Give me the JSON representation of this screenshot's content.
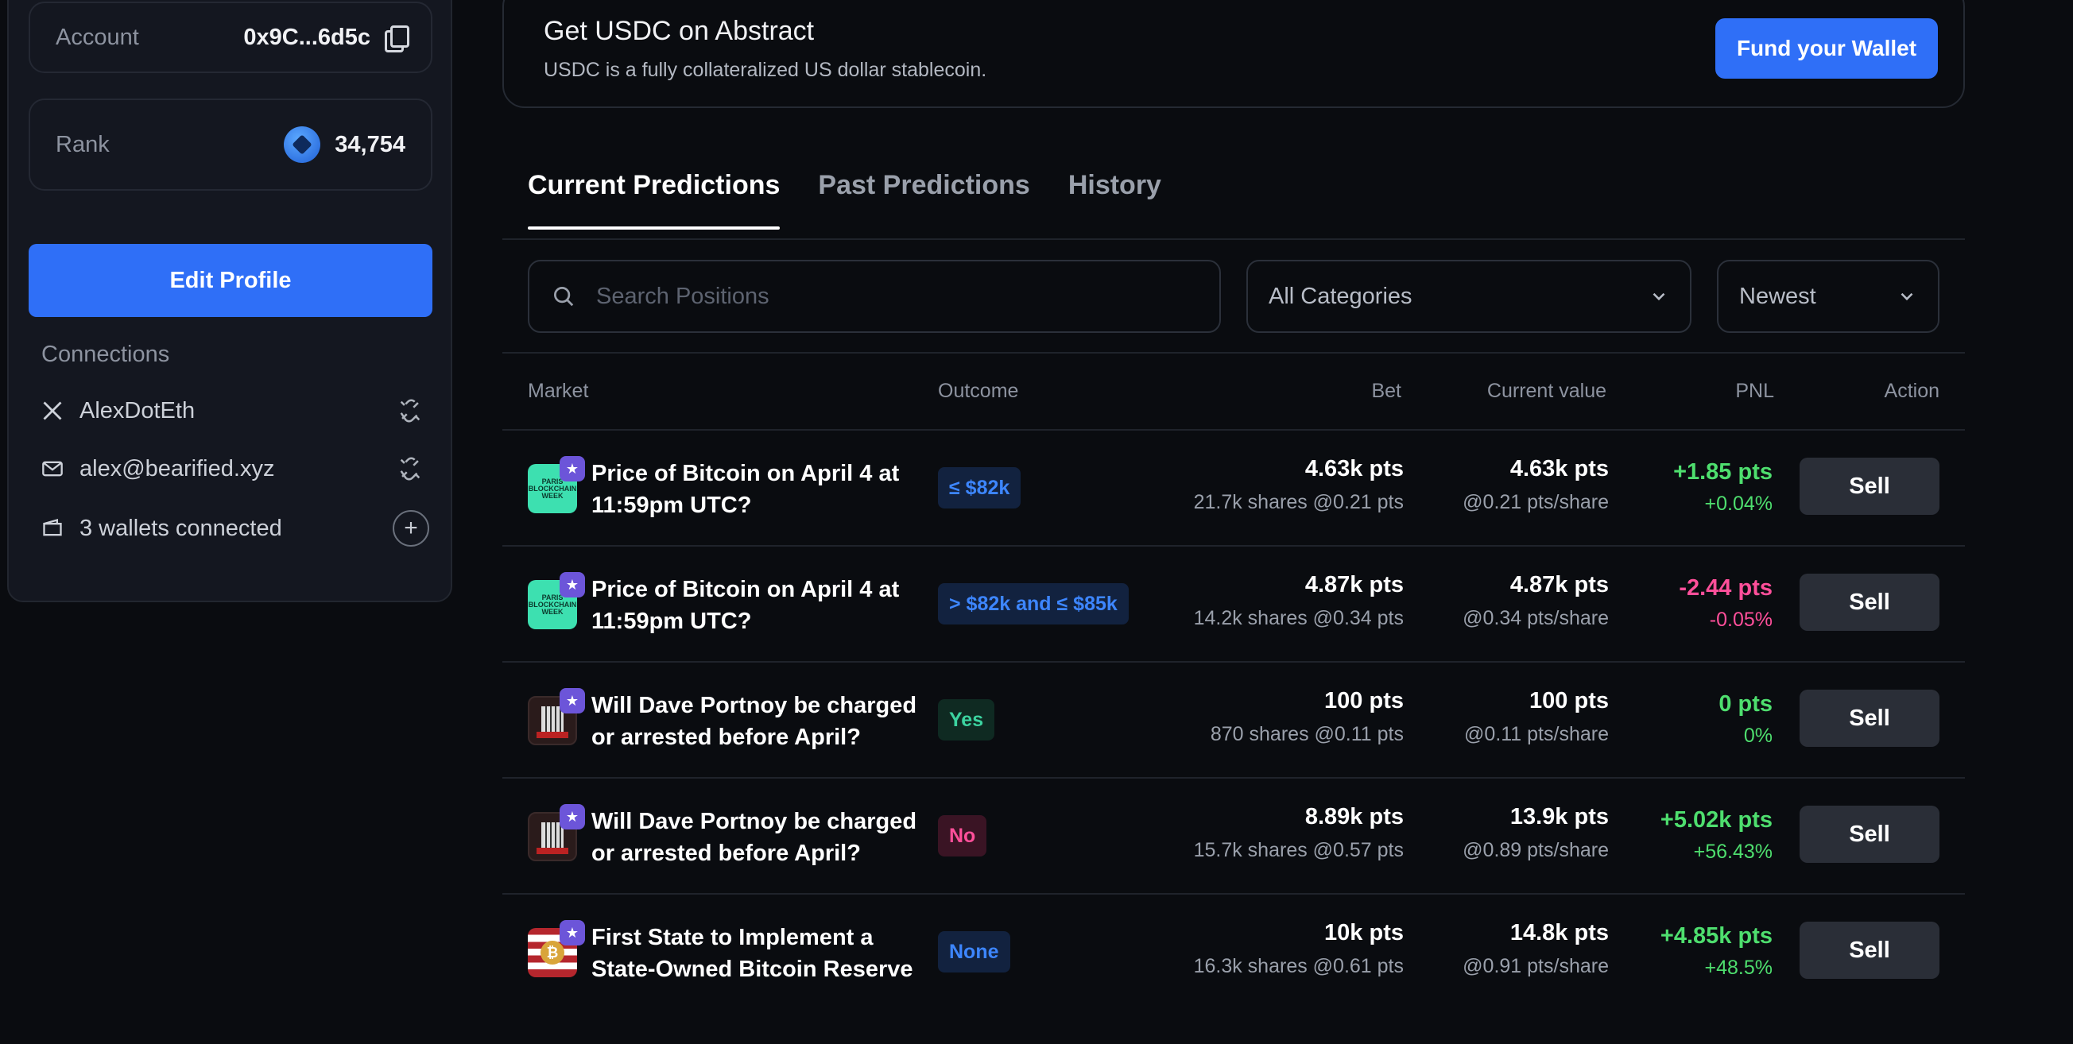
{
  "profile": {
    "account_label": "Account",
    "account_value": "0x9C...6d5c",
    "rank_label": "Rank",
    "rank_value": "34,754",
    "edit_button": "Edit Profile",
    "connections_title": "Connections",
    "connections": [
      {
        "icon": "x-logo-icon",
        "label": "AlexDotEth"
      },
      {
        "icon": "mail-icon",
        "label": "alex@bearified.xyz"
      },
      {
        "icon": "wallet-icon",
        "label": "3 wallets connected"
      }
    ]
  },
  "banner": {
    "title": "Get USDC on Abstract",
    "subtitle": "USDC is a fully collateralized US dollar stablecoin.",
    "button": "Fund your Wallet"
  },
  "tabs": [
    "Current Predictions",
    "Past Predictions",
    "History"
  ],
  "filters": {
    "search_placeholder": "Search Positions",
    "category": "All Categories",
    "sort": "Newest"
  },
  "table": {
    "headers": {
      "market": "Market",
      "outcome": "Outcome",
      "bet": "Bet",
      "current": "Current value",
      "pnl": "PNL",
      "action": "Action"
    },
    "rows": [
      {
        "market": "Price of Bitcoin on April 4 at 11:59pm UTC?",
        "outcome": "≤ $82k",
        "bet": "4.63k pts",
        "bet_sub": "21.7k shares @0.21 pts",
        "current": "4.63k pts",
        "current_sub": "@0.21 pts/share",
        "pnl": "+1.85 pts",
        "pnl_pct": "+0.04%",
        "action": "Sell"
      },
      {
        "market": "Price of Bitcoin on April 4 at 11:59pm UTC?",
        "outcome": "> $82k and ≤ $85k",
        "bet": "4.87k pts",
        "bet_sub": "14.2k shares @0.34 pts",
        "current": "4.87k pts",
        "current_sub": "@0.34 pts/share",
        "pnl": "-2.44 pts",
        "pnl_pct": "-0.05%",
        "action": "Sell"
      },
      {
        "market": "Will Dave Portnoy be charged or arrested before April?",
        "outcome": "Yes",
        "bet": "100 pts",
        "bet_sub": "870 shares @0.11 pts",
        "current": "100 pts",
        "current_sub": "@0.11 pts/share",
        "pnl": "0 pts",
        "pnl_pct": "0%",
        "action": "Sell"
      },
      {
        "market": "Will Dave Portnoy be charged or arrested before April?",
        "outcome": "No",
        "bet": "8.89k pts",
        "bet_sub": "15.7k shares @0.57 pts",
        "current": "13.9k pts",
        "current_sub": "@0.89 pts/share",
        "pnl": "+5.02k pts",
        "pnl_pct": "+56.43%",
        "action": "Sell"
      },
      {
        "market": "First State to Implement a State-Owned Bitcoin Reserve",
        "outcome": "None",
        "bet": "10k pts",
        "bet_sub": "16.3k shares @0.61 pts",
        "current": "14.8k pts",
        "current_sub": "@0.91 pts/share",
        "pnl": "+4.85k pts",
        "pnl_pct": "+48.5%",
        "action": "Sell"
      }
    ]
  },
  "colors": {
    "accent": "#2f6ff7",
    "positive": "#4ede6e",
    "negative": "#ff4f9a",
    "background": "#0a0c10"
  }
}
